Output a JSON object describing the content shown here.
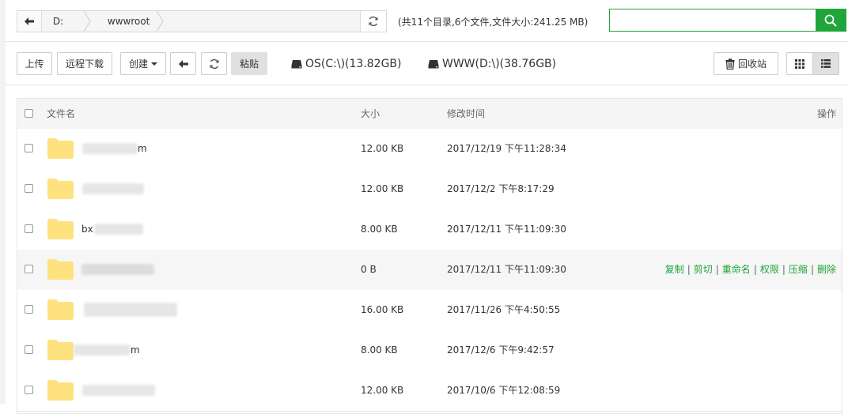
{
  "path": {
    "crumbs": [
      "D:",
      "wwwroot"
    ],
    "summary": "(共11个目录,6个文件,文件大小:241.25 MB)"
  },
  "search": {
    "placeholder": ""
  },
  "toolbar": {
    "upload": "上传",
    "remote_download": "远程下载",
    "create": "创建",
    "paste": "粘贴",
    "disks": [
      "OS(C:\\)(13.82GB)",
      "WWW(D:\\)(38.76GB)"
    ],
    "recycle_bin": "回收站"
  },
  "table": {
    "headers": {
      "name": "文件名",
      "size": "大小",
      "mtime": "修改时间",
      "actions": "操作"
    },
    "rows": [
      {
        "name": "m",
        "size": "12.00 KB",
        "mtime": "2017/12/19 下午11:28:34"
      },
      {
        "name": "",
        "size": "12.00 KB",
        "mtime": "2017/12/2 下午8:17:29"
      },
      {
        "name": "bx",
        "size": "8.00 KB",
        "mtime": "2017/12/11 下午11:09:30"
      },
      {
        "name": "",
        "size": "0 B",
        "mtime": "2017/12/11 下午11:09:30"
      },
      {
        "name": "",
        "size": "16.00 KB",
        "mtime": "2017/11/26 下午4:50:55"
      },
      {
        "name": "m",
        "size": "8.00 KB",
        "mtime": "2017/12/6 下午9:42:57"
      },
      {
        "name": "",
        "size": "12.00 KB",
        "mtime": "2017/10/6 下午12:08:59"
      }
    ],
    "row_actions": [
      "复制",
      "剪切",
      "重命名",
      "权限",
      "压缩",
      "删除"
    ]
  },
  "colors": {
    "accent": "#20a53a",
    "folder": "#fde27f"
  }
}
